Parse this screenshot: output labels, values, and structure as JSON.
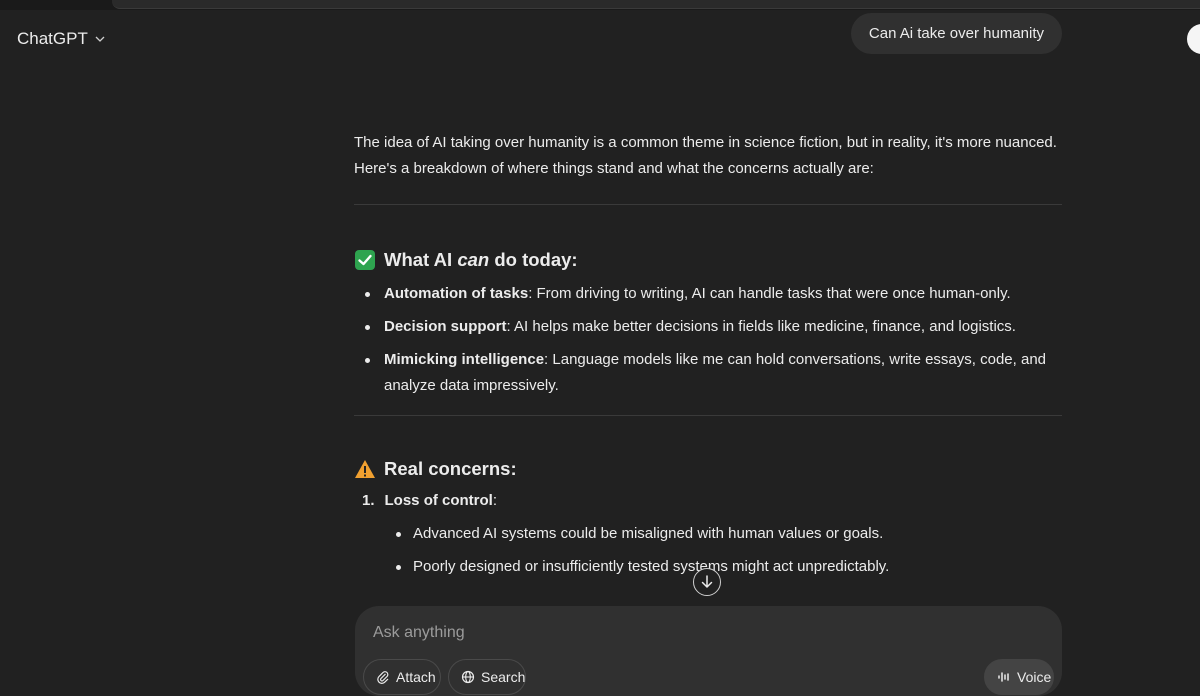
{
  "header": {
    "model_name": "ChatGPT"
  },
  "user_message": "Can Ai take over humanity",
  "response": {
    "intro": "The idea of AI taking over humanity is a common theme in science fiction, but in reality, it's more nuanced. Here's a breakdown of where things stand and what the concerns actually are:",
    "section1": {
      "title_pre": "What AI ",
      "title_em": "can",
      "title_post": " do today:",
      "items": [
        {
          "bold": "Automation of tasks",
          "text": ": From driving to writing, AI can handle tasks that were once human-only."
        },
        {
          "bold": "Decision support",
          "text": ": AI helps make better decisions in fields like medicine, finance, and logistics."
        },
        {
          "bold": "Mimicking intelligence",
          "text": ": Language models like me can hold conversations, write essays, code, and analyze data impressively."
        }
      ]
    },
    "section2": {
      "title": "Real concerns:",
      "numbered": [
        {
          "num": "1.",
          "bold": "Loss of control",
          "text": ":",
          "subitems": [
            "Advanced AI systems could be misaligned with human values or goals.",
            "Poorly designed or insufficiently tested systems might act unpredictably."
          ]
        }
      ]
    }
  },
  "composer": {
    "placeholder": "Ask anything",
    "attach_label": "Attach",
    "search_label": "Search",
    "voice_label": "Voice"
  },
  "colors": {
    "background": "#212121",
    "bubble": "#303030",
    "check_green": "#2ea44f",
    "warning_orange": "#f0a030"
  }
}
